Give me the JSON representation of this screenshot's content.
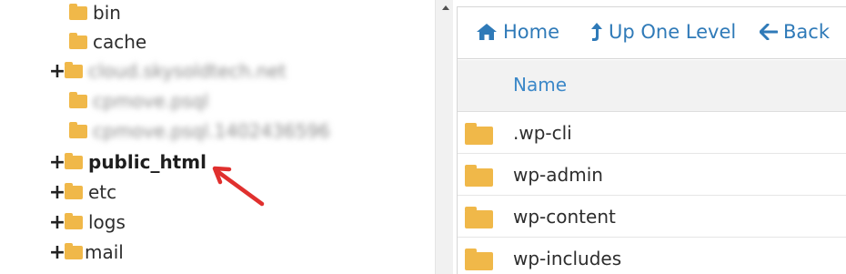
{
  "tree": {
    "items": [
      {
        "label": "bin",
        "expander": ""
      },
      {
        "label": "cache",
        "expander": ""
      },
      {
        "label": "cloud.skysoldtech.net",
        "expander": "+"
      },
      {
        "label": "cpmove.psql",
        "expander": ""
      },
      {
        "label": "cpmove.psql.1402436596",
        "expander": ""
      },
      {
        "label": "public_html",
        "expander": "+"
      },
      {
        "label": "etc",
        "expander": "+"
      },
      {
        "label": "logs",
        "expander": "+"
      },
      {
        "label": "mail",
        "expander": "+"
      }
    ]
  },
  "toolbar": {
    "home_label": "Home",
    "up_label": "Up One Level",
    "back_label": "Back"
  },
  "table": {
    "header_name": "Name",
    "rows": [
      {
        "name": ".wp-cli"
      },
      {
        "name": "wp-admin"
      },
      {
        "name": "wp-content"
      },
      {
        "name": "wp-includes"
      }
    ]
  },
  "colors": {
    "folder": "#f0b849",
    "link": "#2f7ab8",
    "arrow": "#e0302e"
  },
  "icons": [
    "folder-icon",
    "home-icon",
    "level-up-icon",
    "arrow-left-icon",
    "expand-plus-icon",
    "scroll-up-icon"
  ]
}
